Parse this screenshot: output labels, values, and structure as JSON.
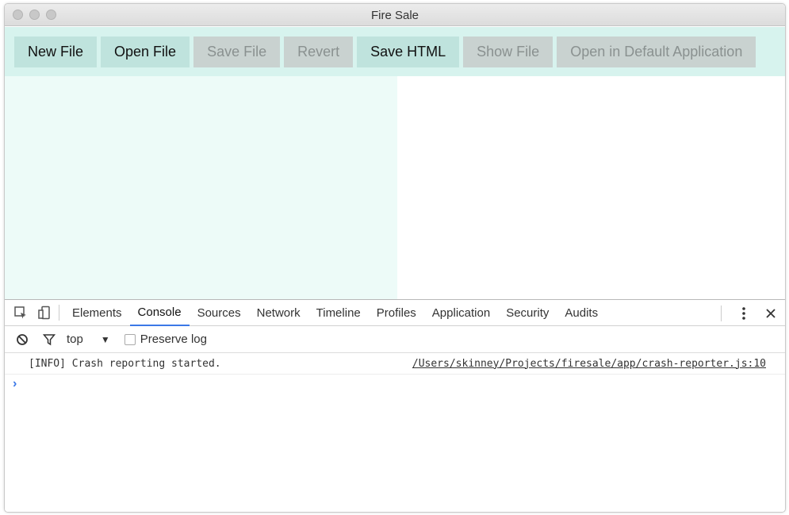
{
  "window": {
    "title": "Fire Sale"
  },
  "toolbar": {
    "buttons": [
      {
        "label": "New File",
        "enabled": true
      },
      {
        "label": "Open File",
        "enabled": true
      },
      {
        "label": "Save File",
        "enabled": false
      },
      {
        "label": "Revert",
        "enabled": false
      },
      {
        "label": "Save HTML",
        "enabled": true
      },
      {
        "label": "Show File",
        "enabled": false
      },
      {
        "label": "Open in Default Application",
        "enabled": false
      }
    ]
  },
  "devtools": {
    "tabs": [
      "Elements",
      "Console",
      "Sources",
      "Network",
      "Timeline",
      "Profiles",
      "Application",
      "Security",
      "Audits"
    ],
    "active_tab": "Console",
    "context": "top",
    "preserve_log_label": "Preserve log",
    "log": {
      "message": "[INFO] Crash reporting started.",
      "source": "/Users/skinney/Projects/firesale/app/crash-reporter.js:10"
    },
    "prompt": "›"
  },
  "colors": {
    "toolbar_bg": "#d7f3ee",
    "button_bg": "#bfe3dd",
    "left_pane_bg": "#edfbf8",
    "accent": "#3b78e7"
  }
}
